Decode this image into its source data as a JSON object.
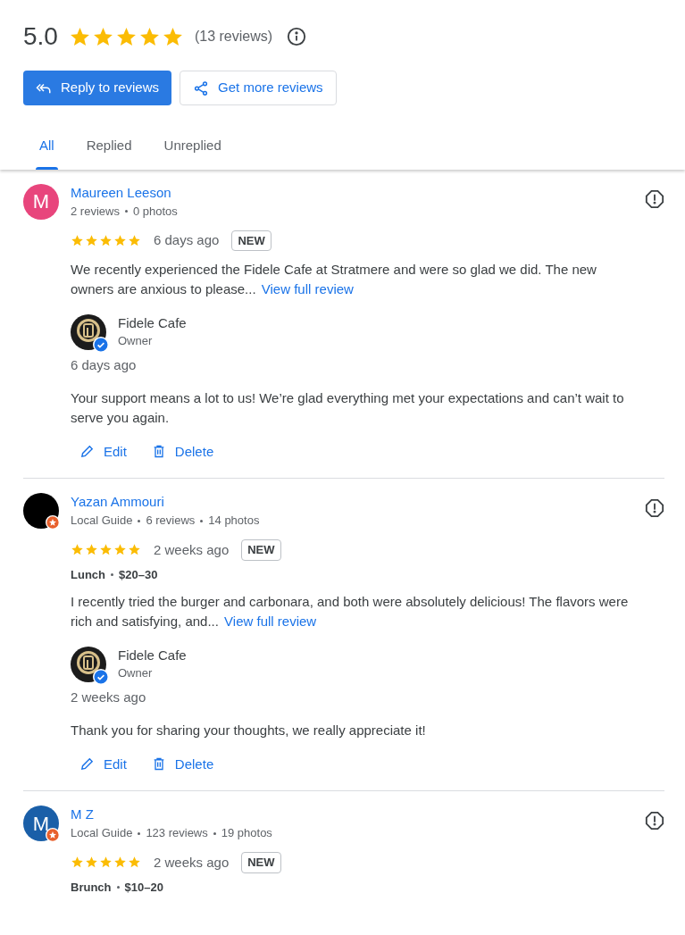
{
  "summary": {
    "rating": "5.0",
    "stars": 5,
    "count": "(13 reviews)"
  },
  "actions": [
    {
      "kind": "primary",
      "label": "Reply to reviews"
    },
    {
      "kind": "secondary",
      "label": "Get more reviews"
    }
  ],
  "tabs": [
    {
      "label": "All",
      "selected": true
    },
    {
      "label": "Replied",
      "selected": false
    },
    {
      "label": "Unreplied",
      "selected": false
    }
  ],
  "reviews": [
    {
      "initial": "M",
      "color": "#e8457c",
      "guide_badge": false,
      "name": "Maureen Leeson",
      "meta": [
        "2 reviews",
        "0 photos"
      ],
      "stars": 5,
      "time": "6 days ago",
      "badge": "NEW",
      "text": "We recently experienced the Fidele Cafe at Stratmere and were so glad we did. The new owners are anxious to please...",
      "more": "View full review",
      "reply": {
        "name": "Fidele Cafe",
        "role": "Owner",
        "time": "6 days ago",
        "text": "Your support means a lot to us! We’re glad everything met your expectations and can’t wait to serve you again.",
        "edit": "Edit",
        "delete": "Delete"
      }
    },
    {
      "color": "#000000",
      "guide_badge": true,
      "name": "Yazan Ammouri",
      "meta": [
        "Local Guide",
        "6 reviews",
        "14 photos"
      ],
      "stars": 5,
      "time": "2 weeks ago",
      "badge": "NEW",
      "details": [
        "Lunch",
        "$20–30"
      ],
      "text": "I recently tried the burger and carbonara, and both were absolutely delicious! The flavors were rich and satisfying, and...",
      "more": "View full review",
      "reply": {
        "name": "Fidele Cafe",
        "role": "Owner",
        "time": "2 weeks ago",
        "text": "Thank you for sharing your thoughts, we really appreciate it!",
        "edit": "Edit",
        "delete": "Delete"
      }
    },
    {
      "initial": "M",
      "color": "#1a5fa8",
      "guide_badge": true,
      "name": "M Z",
      "meta": [
        "Local Guide",
        "123 reviews",
        "19 photos"
      ],
      "stars": 5,
      "time": "2 weeks ago",
      "badge": "NEW",
      "details": [
        "Brunch",
        "$10–20"
      ]
    }
  ]
}
